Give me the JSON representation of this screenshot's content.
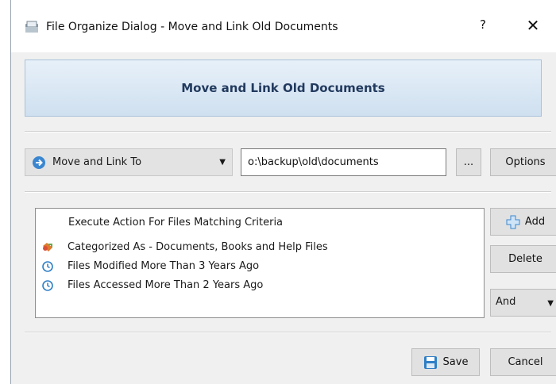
{
  "window": {
    "title": "File Organize Dialog - Move and Link Old Documents",
    "help_glyph": "?",
    "close_glyph": "✕"
  },
  "banner": {
    "title": "Move and Link Old Documents"
  },
  "action": {
    "selected": "Move and Link To",
    "target_path": "o:\\backup\\old\\documents",
    "browse_label": "...",
    "options_label": "Options"
  },
  "criteria": {
    "header": "Execute Action For Files Matching Criteria",
    "items": [
      {
        "text": "Categorized As - Documents, Books and Help Files",
        "icon": "category-icon"
      },
      {
        "text": "Files Modified More Than 3 Years Ago",
        "icon": "clock-icon"
      },
      {
        "text": "Files Accessed More Than 2 Years Ago",
        "icon": "clock-icon"
      }
    ],
    "add_label": "Add",
    "delete_label": "Delete",
    "logic_selected": "And"
  },
  "footer": {
    "save_label": "Save",
    "cancel_label": "Cancel"
  },
  "colors": {
    "accent": "#223a5e",
    "banner_bg": "#cfe0f0",
    "window_bg": "#f0f0f0"
  }
}
